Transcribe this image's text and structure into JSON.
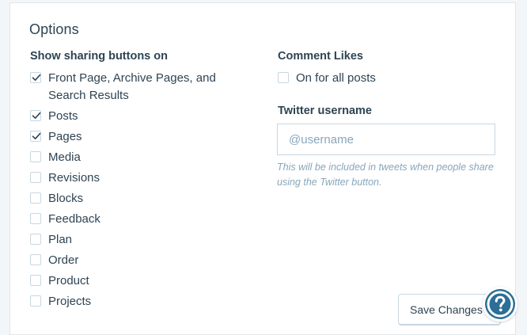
{
  "section": {
    "title": "Options"
  },
  "sharing": {
    "label": "Show sharing buttons on",
    "items": [
      {
        "label": "Front Page, Archive Pages, and Search Results",
        "checked": true
      },
      {
        "label": "Posts",
        "checked": true
      },
      {
        "label": "Pages",
        "checked": true
      },
      {
        "label": "Media",
        "checked": false
      },
      {
        "label": "Revisions",
        "checked": false
      },
      {
        "label": "Blocks",
        "checked": false
      },
      {
        "label": "Feedback",
        "checked": false
      },
      {
        "label": "Plan",
        "checked": false
      },
      {
        "label": "Order",
        "checked": false
      },
      {
        "label": "Product",
        "checked": false
      },
      {
        "label": "Projects",
        "checked": false
      }
    ]
  },
  "comment_likes": {
    "label": "Comment Likes",
    "option_label": "On for all posts",
    "checked": false
  },
  "twitter": {
    "label": "Twitter username",
    "placeholder": "@username",
    "value": "",
    "help": "This will be included in tweets when people share using the Twitter button."
  },
  "actions": {
    "save_label": "Save Changes"
  },
  "help_fab": {
    "icon": "question-mark-icon",
    "color": "#2c6e96"
  }
}
